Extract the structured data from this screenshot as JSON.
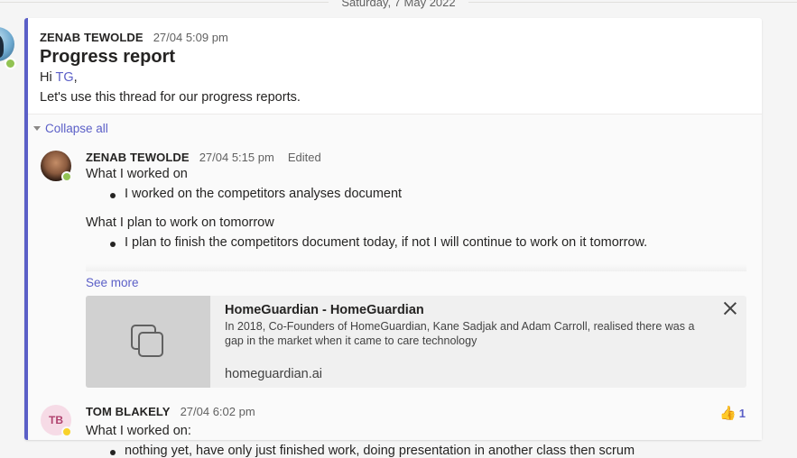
{
  "date_divider": "Saturday, 7 May 2022",
  "root_post": {
    "author": "ZENAB TEWOLDE",
    "time": "27/04 5:09 pm",
    "title": "Progress report",
    "greeting_prefix": "Hi",
    "mention": "TG",
    "greeting_suffix": ",",
    "body": "Let's use this thread for our progress reports."
  },
  "collapse_label": "Collapse all",
  "reply1": {
    "author": "ZENAB TEWOLDE",
    "time": "27/04 5:15 pm",
    "edited": "Edited",
    "heading1": "What I worked on",
    "bullet1": "I worked on the competitors analyses document",
    "heading2": "What I plan to work on tomorrow",
    "bullet2": "I plan to finish the competitors document today, if not I will continue to work on it tomorrow.",
    "see_more": "See more",
    "link_preview": {
      "title": "HomeGuardian - HomeGuardian",
      "description": "In 2018, Co-Founders of HomeGuardian, Kane Sadjak and Adam Carroll, realised there was a gap in the market when it came to care technology",
      "domain": "homeguardian.ai"
    }
  },
  "reply2": {
    "avatar_initials": "TB",
    "author": "TOM BLAKELY",
    "time": "27/04 6:02 pm",
    "heading": "What I worked on:",
    "bullet": "nothing yet, have only just finished work, doing presentation in another class then scrum",
    "reaction_count": "1"
  },
  "colors": {
    "accent": "#5b5fc7",
    "available": "#92c353",
    "away": "#f8d22a"
  }
}
